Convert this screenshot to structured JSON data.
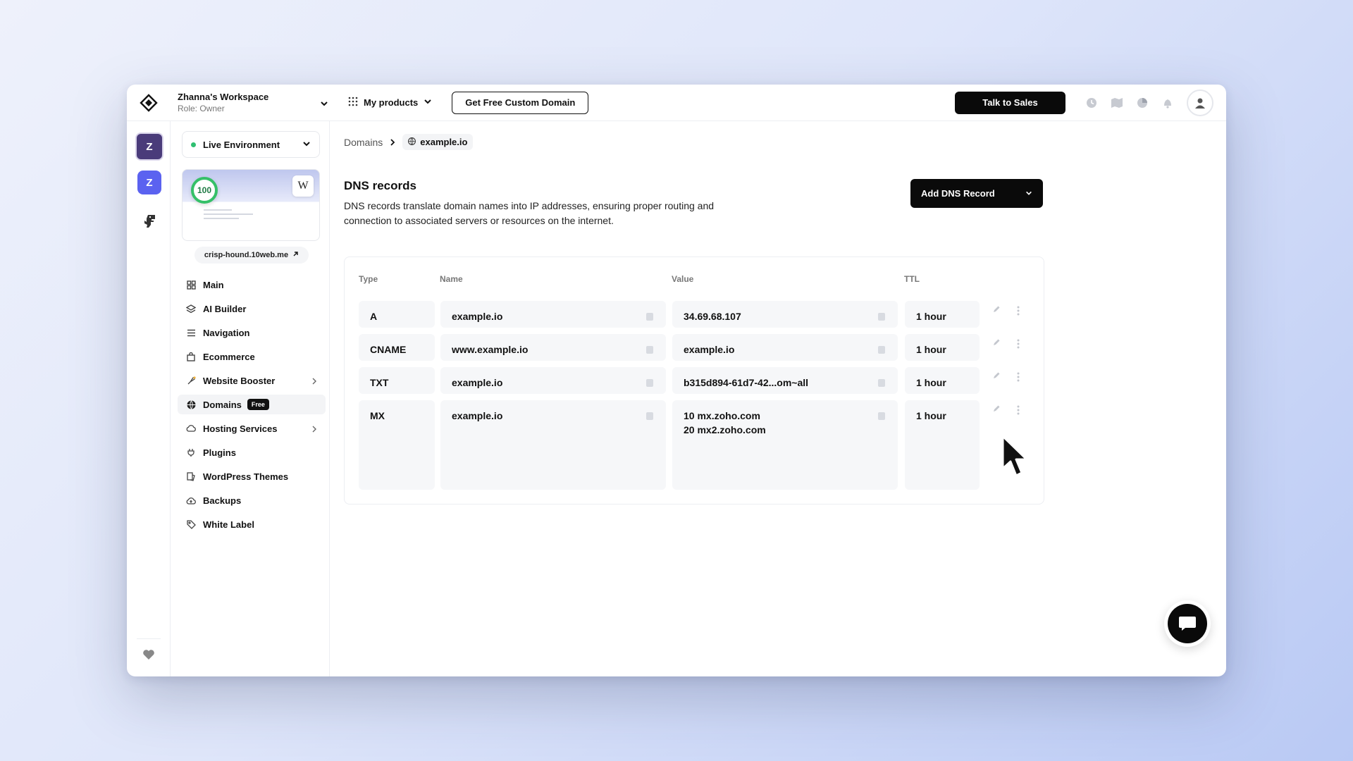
{
  "workspace": {
    "name": "Zhanna's Workspace",
    "role": "Role: Owner"
  },
  "topbar": {
    "products_label": "My products",
    "custom_domain_label": "Get Free Custom Domain",
    "sales_label": "Talk to Sales",
    "icons": [
      "clock-icon",
      "map-icon",
      "pie-chart-icon",
      "bell-icon",
      "user-avatar-icon"
    ]
  },
  "rail": {
    "items": [
      {
        "letter": "Z"
      },
      {
        "letter": "Z"
      }
    ]
  },
  "sidebar": {
    "environment": "Live Environment",
    "score": "100",
    "wp_letter": "W",
    "site_url": "crisp-hound.10web.me",
    "items": [
      {
        "label": "Main",
        "icon": "grid-icon"
      },
      {
        "label": "AI Builder",
        "icon": "layers-icon"
      },
      {
        "label": "Navigation",
        "icon": "menu-icon"
      },
      {
        "label": "Ecommerce",
        "icon": "bag-icon"
      },
      {
        "label": "Website Booster",
        "icon": "rocket-icon"
      },
      {
        "label": "Domains",
        "icon": "globe-icon",
        "badge": "Free"
      },
      {
        "label": "Hosting Services",
        "icon": "cloud-icon"
      },
      {
        "label": "Plugins",
        "icon": "plug-icon"
      },
      {
        "label": "WordPress Themes",
        "icon": "theme-icon"
      },
      {
        "label": "Backups",
        "icon": "cloud-backup-icon"
      },
      {
        "label": "White Label",
        "icon": "tag-icon"
      }
    ]
  },
  "breadcrumb": {
    "root": "Domains",
    "current": "example.io"
  },
  "dns": {
    "title": "DNS records",
    "description": "DNS records translate domain names into IP addresses, ensuring proper routing and connection to associated servers or resources on the internet.",
    "add_label": "Add DNS Record",
    "columns": {
      "type": "Type",
      "name": "Name",
      "value": "Value",
      "ttl": "TTL"
    },
    "rows": [
      {
        "type": "A",
        "name": "example.io",
        "value": "34.69.68.107",
        "value2": "",
        "ttl": "1 hour"
      },
      {
        "type": "CNAME",
        "name": "www.example.io",
        "value": "example.io",
        "value2": "",
        "ttl": "1 hour"
      },
      {
        "type": "TXT",
        "name": "example.io",
        "value": "b315d894-61d7-42...om~all",
        "value2": "",
        "ttl": "1 hour"
      },
      {
        "type": "MX",
        "name": "example.io",
        "value": "10 mx.zoho.com",
        "value2": "20 mx2.zoho.com",
        "ttl": "1 hour"
      }
    ]
  }
}
